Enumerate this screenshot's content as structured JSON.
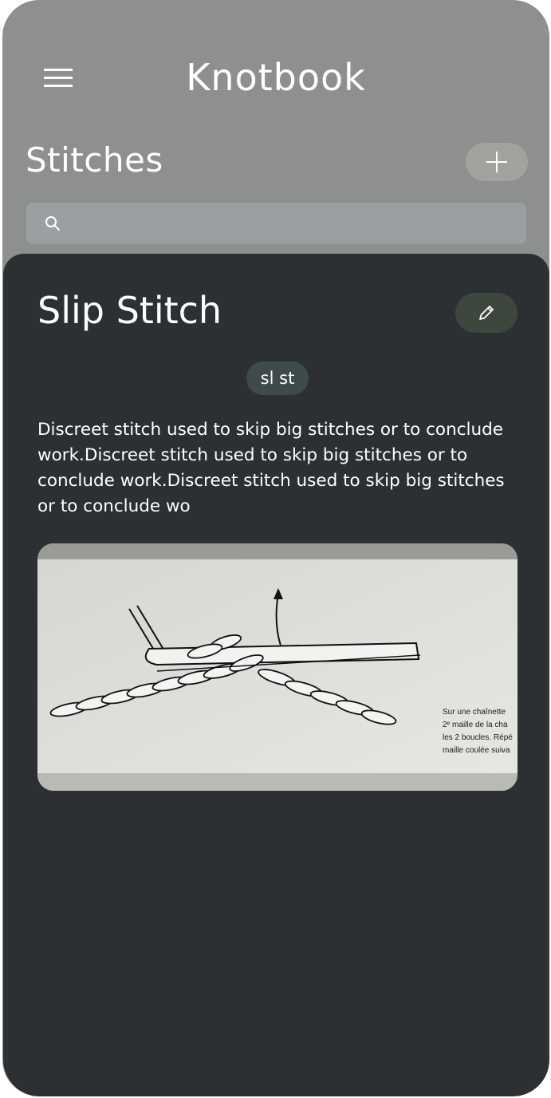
{
  "header": {
    "app_title": "Knotbook",
    "menu_icon": "hamburger-menu-icon"
  },
  "stitches_section": {
    "title": "Stitches",
    "add_icon": "plus-icon"
  },
  "search": {
    "placeholder": "",
    "value": "",
    "icon": "search-icon"
  },
  "stitch_detail": {
    "name": "Slip Stitch",
    "abbreviation": "sl st",
    "edit_icon": "pencil-icon",
    "description": "Discreet stitch used to skip big stitches or to conclude work.Discreet stitch used to skip big stitches or to conclude work.Discreet stitch used to skip big stitches or to conclude wo",
    "diagram_caption_lines": [
      "Sur une chaînette",
      "2ᵉ maille de la cha",
      "les 2 boucles. Répé",
      "maille coulée suiva"
    ]
  },
  "colors": {
    "header_bg": "#8e908f",
    "sheet_bg": "#2c3033",
    "add_button_bg": "#a0a39e",
    "search_bg": "#9aa0a1",
    "edit_button_bg": "#3e473e",
    "chip_bg": "#3e4b4a",
    "text": "#ffffff"
  }
}
